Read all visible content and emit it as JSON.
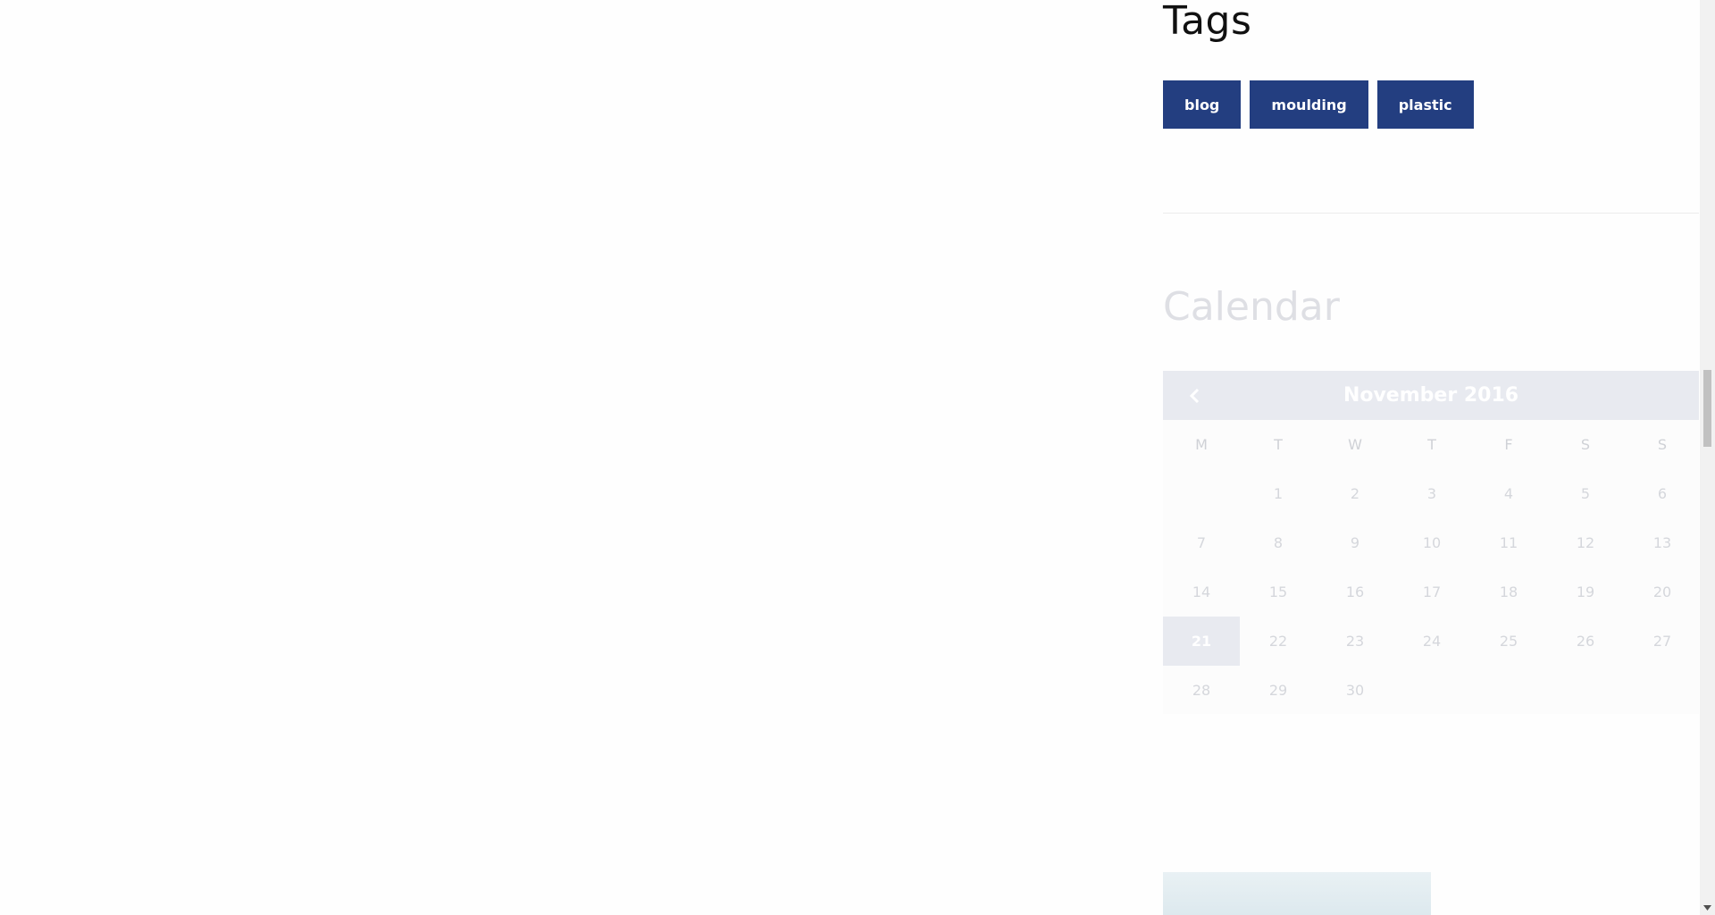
{
  "tags": {
    "title": "Tags",
    "items": [
      "blog",
      "moulding",
      "plastic"
    ]
  },
  "calendar": {
    "title": "Calendar",
    "month": "November 2016",
    "weekdays": [
      "M",
      "T",
      "W",
      "T",
      "F",
      "S",
      "S"
    ],
    "days": [
      "",
      "1",
      "2",
      "3",
      "4",
      "5",
      "6",
      "7",
      "8",
      "9",
      "10",
      "11",
      "12",
      "13",
      "14",
      "15",
      "16",
      "17",
      "18",
      "19",
      "20",
      "21",
      "22",
      "23",
      "24",
      "25",
      "26",
      "27",
      "28",
      "29",
      "30",
      "",
      "",
      "",
      ""
    ],
    "today": "21",
    "prev_icon": "chevron-left-icon"
  },
  "colors": {
    "tag_bg": "#233e80",
    "calendar_header": "#e8eaf0"
  }
}
